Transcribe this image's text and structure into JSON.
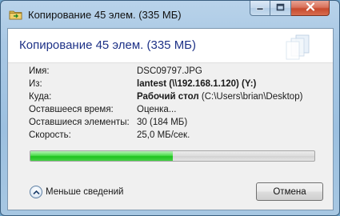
{
  "window": {
    "title": "Копирование 45 элем. (335 МБ)"
  },
  "dialog": {
    "heading": "Копирование 45 элем. (335 МБ)",
    "rows": [
      {
        "label": "Имя:",
        "value": "DSC09797.JPG",
        "value_bold": "",
        "value_rest": ""
      },
      {
        "label": "Из:",
        "value": "",
        "value_bold": "lantest (\\\\192.168.1.120) (Y:)",
        "value_rest": ""
      },
      {
        "label": "Куда:",
        "value": "",
        "value_bold": "Рабочий стол",
        "value_rest": " (C:\\Users\\brian\\Desktop)"
      },
      {
        "label": "Оставшееся время:",
        "value": "Оценка...",
        "value_bold": "",
        "value_rest": ""
      },
      {
        "label": "Оставшиеся элементы:",
        "value": "30 (184 МБ)",
        "value_bold": "",
        "value_rest": ""
      },
      {
        "label": "Скорость:",
        "value": "25,0 МБ/сек.",
        "value_bold": "",
        "value_rest": ""
      }
    ],
    "progress_percent": 50,
    "progress_color": "#2ecc2e",
    "less_details_label": "Меньше сведений",
    "cancel_label": "Отмена"
  },
  "icons": {
    "app": "copy-folder-icon",
    "minimize": "minimize-icon",
    "maximize": "maximize-icon",
    "close": "close-icon",
    "chevron": "chevron-up-icon",
    "file_graphic": "file-transfer-icon"
  }
}
